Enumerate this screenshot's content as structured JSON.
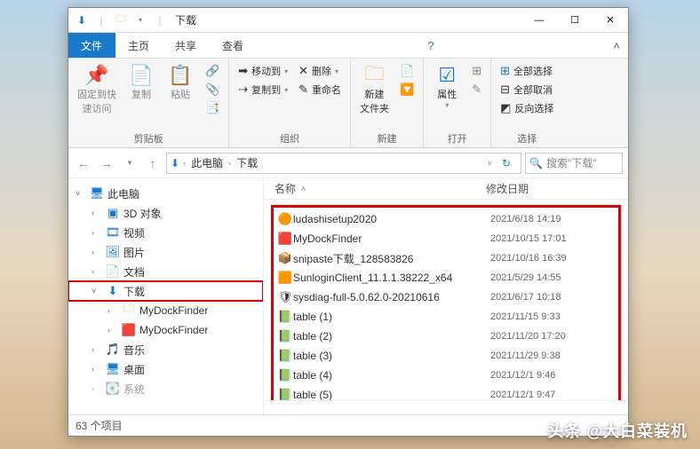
{
  "window": {
    "title": "下载",
    "tabs": {
      "file": "文件",
      "home": "主页",
      "share": "共享",
      "view": "查看"
    },
    "win_controls": {
      "min": "—",
      "max": "☐",
      "close": "✕"
    }
  },
  "ribbon": {
    "pin": {
      "label": "固定到快\n速访问"
    },
    "copy": "复制",
    "paste": "粘贴",
    "clipboard_group": "剪贴板",
    "move_to": "移动到",
    "copy_to": "复制到",
    "delete": "删除",
    "rename": "重命名",
    "organize_group": "组织",
    "new_folder": "新建\n文件夹",
    "new_group": "新建",
    "properties": "属性",
    "open_group": "打开",
    "select_all": "全部选择",
    "select_none": "全部取消",
    "invert_selection": "反向选择",
    "select_group": "选择"
  },
  "address": {
    "crumb_pc": "此电脑",
    "crumb_downloads": "下载",
    "refresh_tip": "↻"
  },
  "search": {
    "placeholder": "搜索\"下载\""
  },
  "tree": {
    "this_pc": "此电脑",
    "objects_3d": "3D 对象",
    "videos": "视频",
    "pictures": "图片",
    "documents": "文档",
    "downloads": "下载",
    "mydock1": "MyDockFinder",
    "mydock2": "MyDockFinder",
    "music": "音乐",
    "desktop": "桌面",
    "system": "系统"
  },
  "columns": {
    "name": "名称",
    "modified": "修改日期"
  },
  "files": [
    {
      "icon": "🟠",
      "name": "ludashisetup2020",
      "date": "2021/6/18 14:19"
    },
    {
      "icon": "🟥",
      "name": "MyDockFinder",
      "date": "2021/10/15 17:01"
    },
    {
      "icon": "📦",
      "name": "snipaste下载_128583826",
      "date": "2021/10/16 16:39"
    },
    {
      "icon": "🟧",
      "name": "SunloginClient_11.1.1.38222_x64",
      "date": "2021/5/29 14:55"
    },
    {
      "icon": "🛡",
      "name": "sysdiag-full-5.0.62.0-20210616",
      "date": "2021/6/17 10:18"
    },
    {
      "icon": "📗",
      "name": "table (1)",
      "date": "2021/11/15 9:33"
    },
    {
      "icon": "📗",
      "name": "table (2)",
      "date": "2021/11/20 17:20"
    },
    {
      "icon": "📗",
      "name": "table (3)",
      "date": "2021/11/29 9:38"
    },
    {
      "icon": "📗",
      "name": "table (4)",
      "date": "2021/12/1 9:46"
    },
    {
      "icon": "📗",
      "name": "table (5)",
      "date": "2021/12/1 9:47"
    }
  ],
  "status": {
    "item_count": "63 个项目"
  },
  "watermark": "头条 @大白菜装机"
}
